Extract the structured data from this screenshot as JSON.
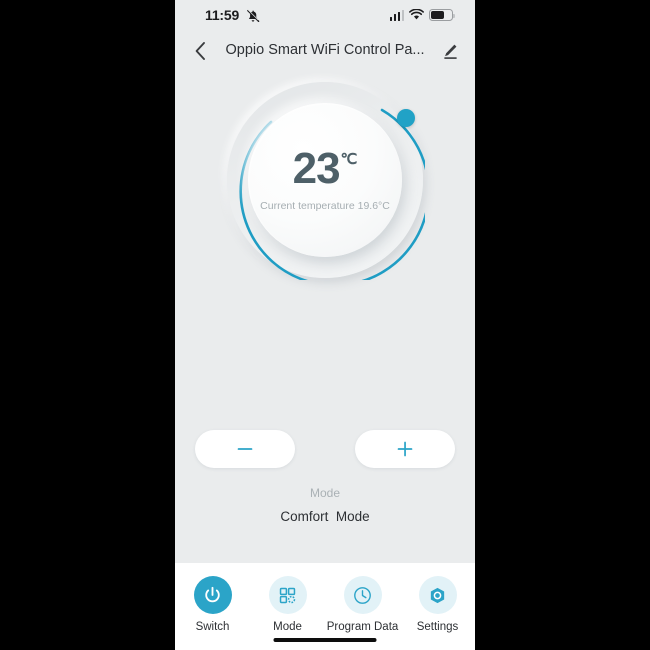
{
  "theme": {
    "accent": "#2ba4c8",
    "accent_soft": "#e2f2f7",
    "page_bg": "#eaeced",
    "text_dark": "#2d3034",
    "text_muted": "#a6aeb2",
    "temp_text": "#4e6068"
  },
  "status_bar": {
    "time": "11:59",
    "bell_icon": "bell-mute-icon",
    "signal_icon": "cellular-signal-icon",
    "wifi_icon": "wifi-icon",
    "battery_icon": "battery-icon"
  },
  "title_bar": {
    "back_icon": "chevron-left-icon",
    "title": "Oppio Smart WiFi Control Pa...",
    "edit_icon": "pencil-icon"
  },
  "dial": {
    "target_temp": "23",
    "unit": "℃",
    "current_temp_text": "Current temperature 19.6°C",
    "arc_color": "#1f9dc4",
    "knob_color": "#21a2c6"
  },
  "stepper": {
    "decrease_label": "−",
    "decrease_icon": "minus-icon",
    "increase_label": "+",
    "increase_icon": "plus-icon"
  },
  "mode": {
    "label": "Mode",
    "value": "Comfort  Mode"
  },
  "bottom_nav": {
    "items": [
      {
        "label": "Switch",
        "icon": "power-icon",
        "active": true
      },
      {
        "label": "Mode",
        "icon": "grid-icon",
        "active": false
      },
      {
        "label": "Program Data",
        "icon": "clock-icon",
        "active": false
      },
      {
        "label": "Settings",
        "icon": "settings-hex-icon",
        "active": false
      }
    ]
  },
  "chart_data": {
    "type": "gauge",
    "title": "Thermostat target temperature dial",
    "value": 23,
    "current_value": 19.6,
    "unit": "°C",
    "range": [
      5,
      35
    ],
    "arc_sweep_degrees": 300,
    "knob_angle_degrees": 55,
    "grid": false,
    "legend": "none"
  }
}
